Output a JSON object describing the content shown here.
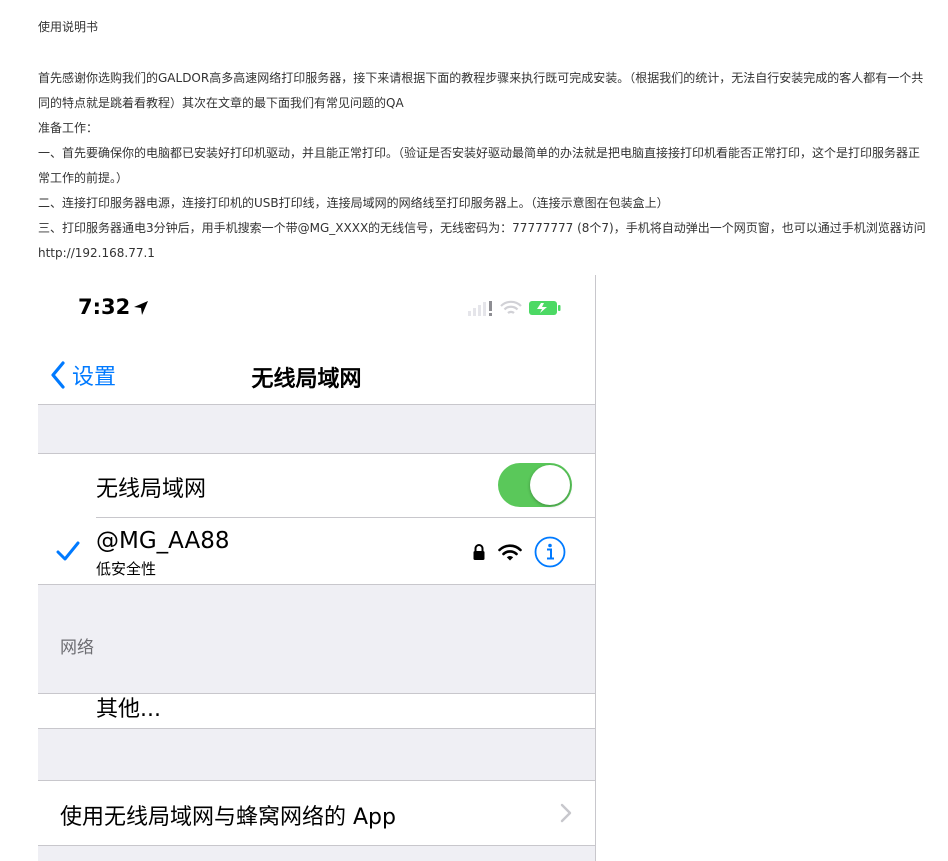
{
  "document": {
    "title": "使用说明书",
    "paragraphs": [
      "首先感谢你选购我们的GALDOR高多高速网络打印服务器，接下来请根据下面的教程步骤来执行既可完成安装。（根据我们的统计，无法自行安装完成的客人都有一个共同的特点就是跳着看教程）其次在文章的最下面我们有常见问题的QA",
      "准备工作：",
      "一、首先要确保你的电脑都已安装好打印机驱动，并且能正常打印。（验证是否安装好驱动最简单的办法就是把电脑直接接打印机看能否正常打印，这个是打印服务器正常工作的前提。）",
      "二、连接打印服务器电源，连接打印机的USB打印线，连接局域网的网络线至打印服务器上。（连接示意图在包装盒上）",
      "三、打印服务器通电3分钟后，用手机搜索一个带@MG_XXXX的无线信号，无线密码为：77777777 (8个7)，手机将自动弹出一个网页窗，也可以通过手机浏览器访问http://192.168.77.1"
    ]
  },
  "phone": {
    "status": {
      "time": "7:32"
    },
    "nav": {
      "back_label": "设置",
      "title": "无线局域网"
    },
    "wifi_toggle": {
      "label": "无线局域网",
      "on": true
    },
    "connected": {
      "name": "@MG_AA88",
      "subtitle": "低安全性"
    },
    "section_networks": "网络",
    "other_label": "其他...",
    "apps_label": "使用无线局域网与蜂窝网络的 App",
    "colors": {
      "accent": "#007aff",
      "toggle_on": "#5ac85a",
      "battery": "#4cd964",
      "group_bg": "#efeff4"
    },
    "icons": [
      "location-arrow-icon",
      "cellular-icon",
      "wifi-icon",
      "battery-icon",
      "chevron-left-icon",
      "checkmark-icon",
      "lock-icon",
      "info-icon",
      "chevron-right-icon"
    ]
  }
}
